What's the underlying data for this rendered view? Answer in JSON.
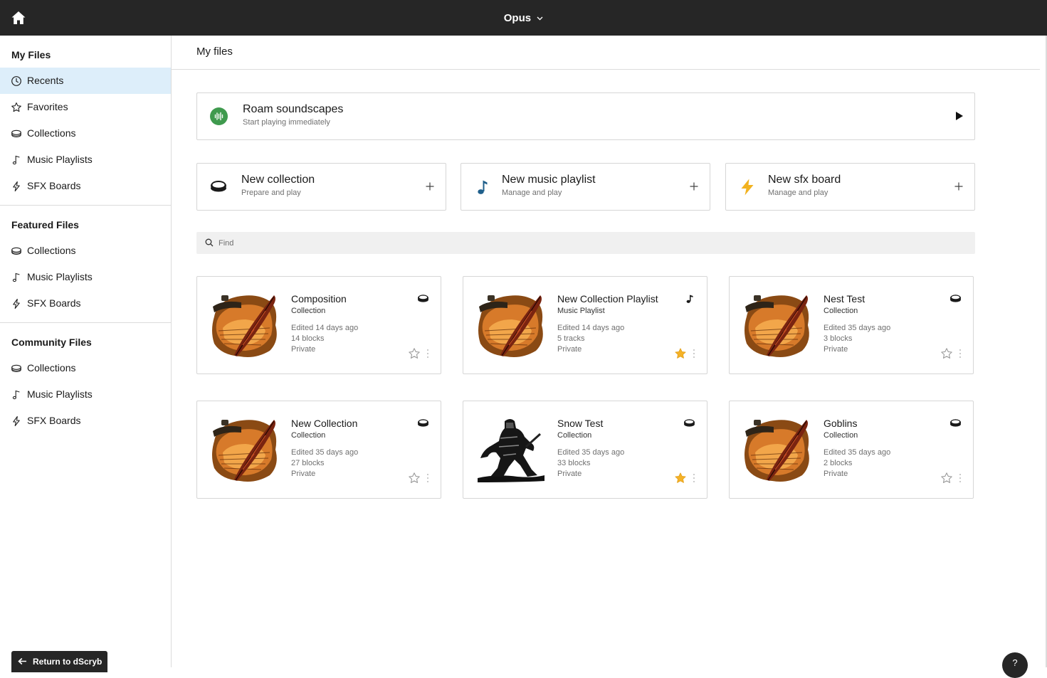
{
  "topbar": {
    "workspace": "Opus"
  },
  "sidebar": {
    "sections": [
      {
        "heading": "My Files",
        "items": [
          {
            "label": "Recents",
            "icon": "clock-icon",
            "active": true
          },
          {
            "label": "Favorites",
            "icon": "star-icon"
          },
          {
            "label": "Collections",
            "icon": "collection-icon"
          },
          {
            "label": "Music Playlists",
            "icon": "music-note-icon"
          },
          {
            "label": "SFX Boards",
            "icon": "lightning-icon"
          }
        ]
      },
      {
        "heading": "Featured Files",
        "items": [
          {
            "label": "Collections",
            "icon": "collection-icon"
          },
          {
            "label": "Music Playlists",
            "icon": "music-note-icon"
          },
          {
            "label": "SFX Boards",
            "icon": "lightning-icon"
          }
        ]
      },
      {
        "heading": "Community Files",
        "items": [
          {
            "label": "Collections",
            "icon": "collection-icon"
          },
          {
            "label": "Music Playlists",
            "icon": "music-note-icon"
          },
          {
            "label": "SFX Boards",
            "icon": "lightning-icon"
          }
        ]
      }
    ],
    "return_label": "Return to dScryb"
  },
  "main": {
    "title": "My files",
    "roam": {
      "title": "Roam soundscapes",
      "subtitle": "Start playing immediately"
    },
    "new_cards": [
      {
        "title": "New collection",
        "subtitle": "Prepare and play",
        "icon": "collection-icon"
      },
      {
        "title": "New music playlist",
        "subtitle": "Manage and play",
        "icon": "music-note-icon"
      },
      {
        "title": "New sfx board",
        "subtitle": "Manage and play",
        "icon": "lightning-icon"
      }
    ],
    "search": {
      "placeholder": "Find"
    },
    "files": [
      {
        "title": "Composition",
        "type": "Collection",
        "edited": "Edited 14 days ago",
        "count": "14 blocks",
        "privacy": "Private",
        "favorite": false,
        "thumb": "quill",
        "type_icon": "collection-icon"
      },
      {
        "title": "New Collection Playlist",
        "type": "Music Playlist",
        "edited": "Edited 14 days ago",
        "count": "5 tracks",
        "privacy": "Private",
        "favorite": true,
        "thumb": "quill",
        "type_icon": "music-note-icon"
      },
      {
        "title": "Nest Test",
        "type": "Collection",
        "edited": "Edited 35 days ago",
        "count": "3 blocks",
        "privacy": "Private",
        "favorite": false,
        "thumb": "quill",
        "type_icon": "collection-icon"
      },
      {
        "title": "New Collection",
        "type": "Collection",
        "edited": "Edited 35 days ago",
        "count": "27 blocks",
        "privacy": "Private",
        "favorite": false,
        "thumb": "quill",
        "type_icon": "collection-icon"
      },
      {
        "title": "Snow Test",
        "type": "Collection",
        "edited": "Edited 35 days ago",
        "count": "33 blocks",
        "privacy": "Private",
        "favorite": true,
        "thumb": "warrior",
        "type_icon": "collection-icon"
      },
      {
        "title": "Goblins",
        "type": "Collection",
        "edited": "Edited 35 days ago",
        "count": "2 blocks",
        "privacy": "Private",
        "favorite": false,
        "thumb": "quill",
        "type_icon": "collection-icon"
      }
    ]
  },
  "help_label": "?",
  "colors": {
    "topbar": "#262626",
    "active_item": "#ddeefa",
    "roam_green": "#3f9a4e",
    "music_blue": "#1f5f8b",
    "sfx_yellow": "#f2b21f",
    "star_gold": "#f5b227"
  }
}
